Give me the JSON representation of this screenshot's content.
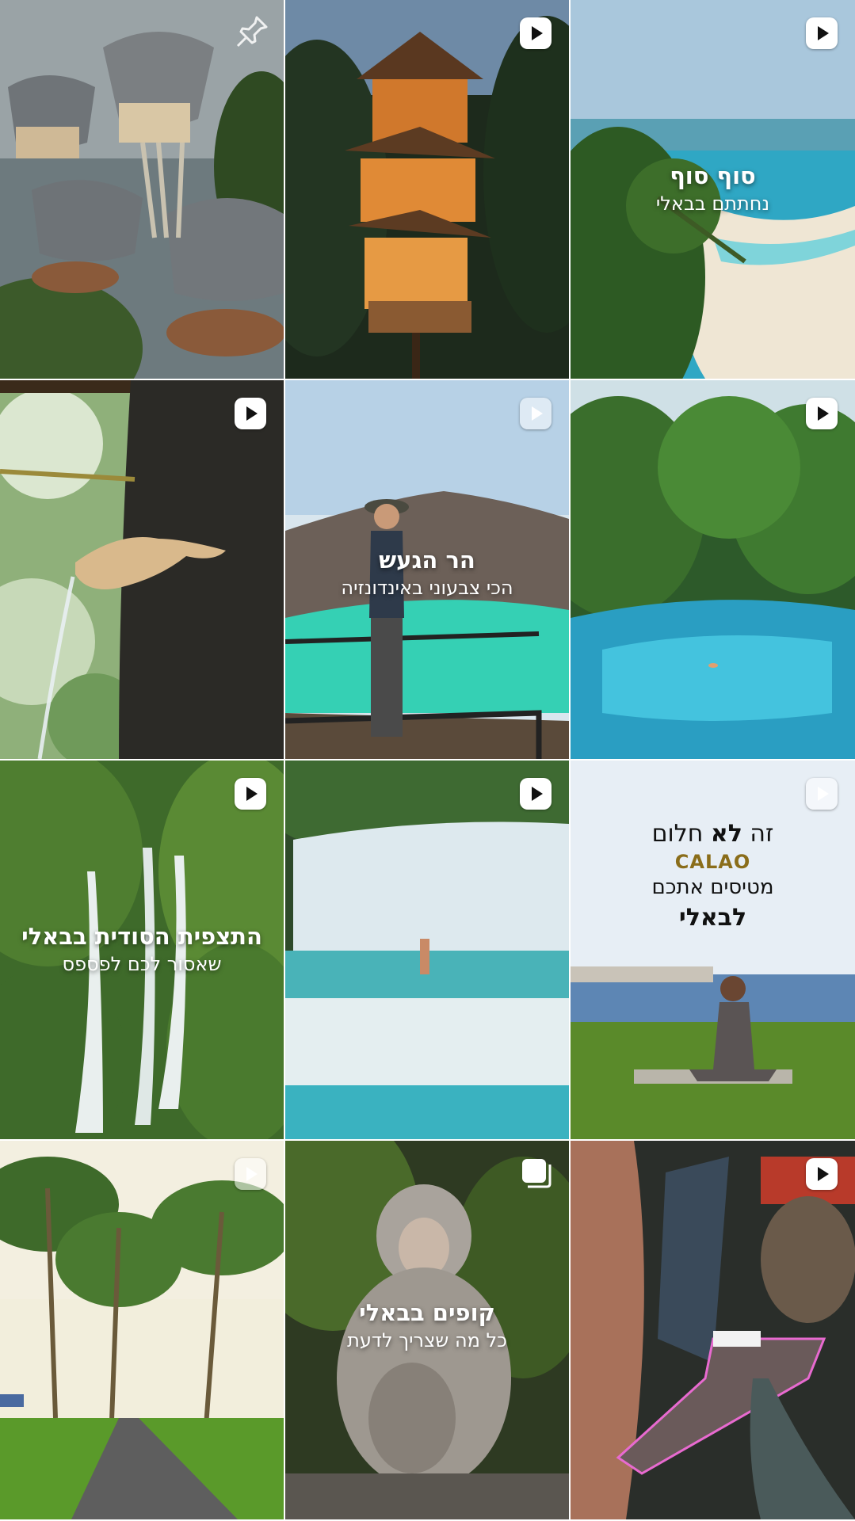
{
  "grid": {
    "tiles": [
      {
        "id": "bamboo-huts",
        "type": "image",
        "badge": "pinned"
      },
      {
        "id": "treehouse-night",
        "type": "reel",
        "badge": "play"
      },
      {
        "id": "beach-aerial",
        "type": "reel",
        "badge": "play",
        "title": "סוף סוף",
        "subtitle": "נחתתם בבאלי"
      },
      {
        "id": "shell-fountain",
        "type": "reel",
        "badge": "play"
      },
      {
        "id": "crater-lake",
        "type": "reel",
        "badge": "play",
        "title": "הר הגעש",
        "subtitle": "הכי צבעוני באינדונזיה"
      },
      {
        "id": "jungle-lagoon",
        "type": "reel",
        "badge": "play"
      },
      {
        "id": "waterfall-jungle",
        "type": "reel",
        "badge": "play",
        "title": "התצפית הסודית בבאלי",
        "subtitle": "שאסור לכם לפספס"
      },
      {
        "id": "cascades",
        "type": "reel",
        "badge": "play"
      },
      {
        "id": "calao-yoga",
        "type": "reel",
        "badge": "play",
        "line1": "זה לא חלום",
        "brand": "CALAO",
        "line3": "מטיסים אתכם",
        "line4": "לבאלי"
      },
      {
        "id": "palm-road",
        "type": "reel",
        "badge": "play"
      },
      {
        "id": "monkeys",
        "type": "carousel",
        "badge": "multi",
        "title": "קופים בבאלי",
        "subtitle": "כל מה שצריך לדעת"
      },
      {
        "id": "canyon-dinner",
        "type": "reel",
        "badge": "play"
      }
    ]
  },
  "colors": {
    "badge": "#ffffff",
    "caption": "#ffffff",
    "brand": "#8a6d1a"
  }
}
